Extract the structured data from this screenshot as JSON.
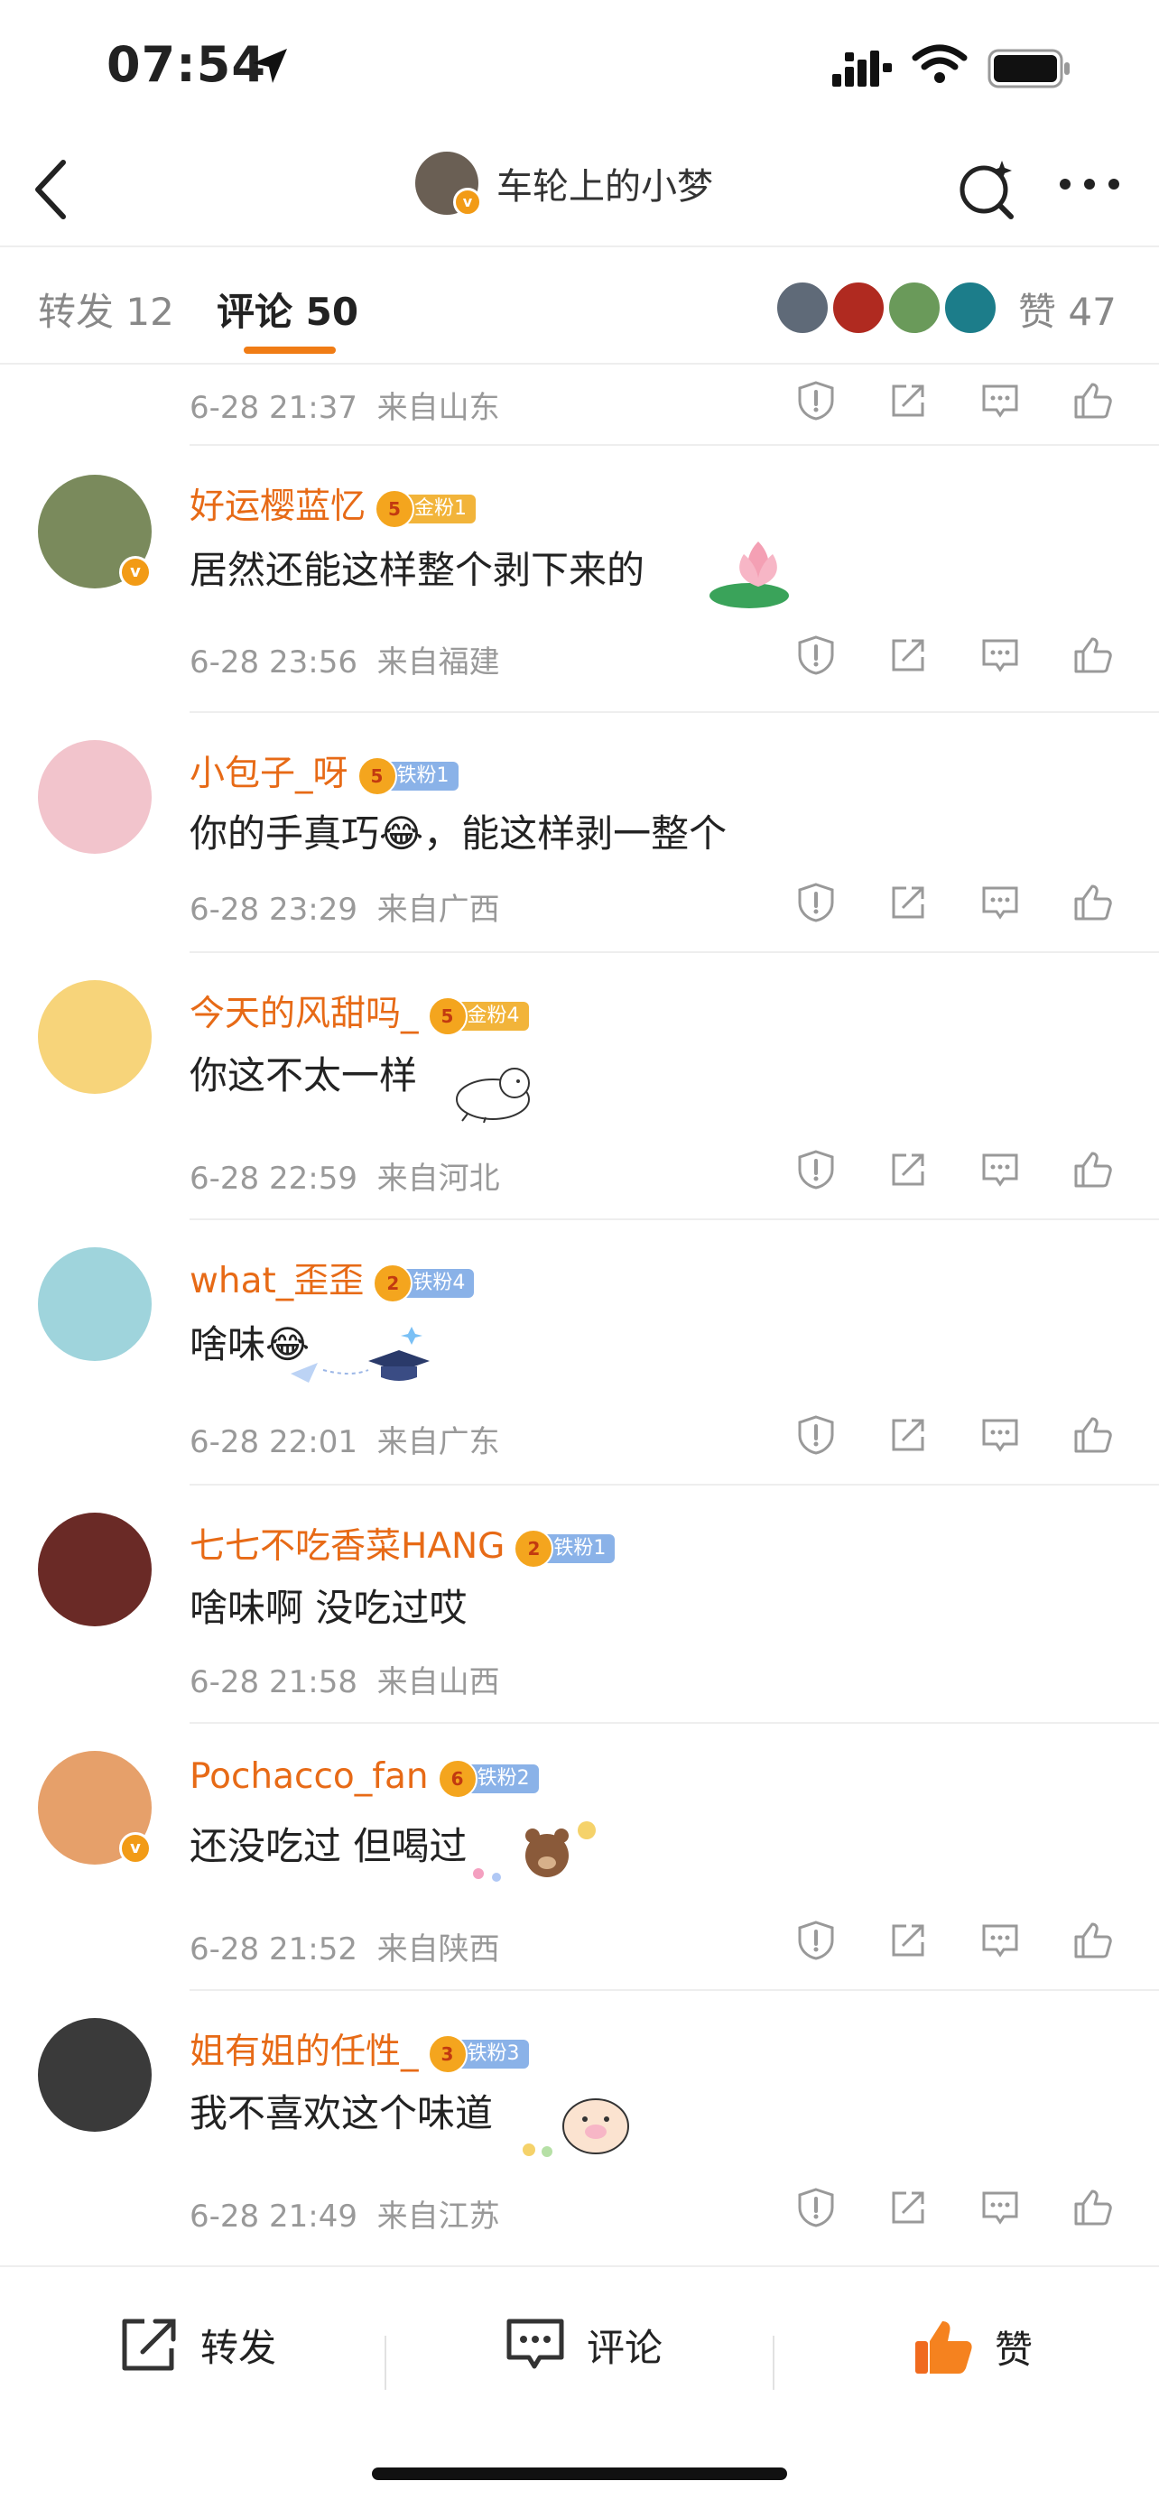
{
  "status": {
    "time": "07:54"
  },
  "header": {
    "title": "车轮上的小梦",
    "vbadge": "v"
  },
  "tabs": {
    "repost": "转发 12",
    "comments": "评论 50",
    "likes": "赞 47"
  },
  "top_meta": {
    "date": "6-28 21:37",
    "location": "来自山东"
  },
  "comments": [
    {
      "user": "好运樱蓝忆",
      "fan": "金粉1",
      "fan_level": "5",
      "text": "居然还能这样整个剥下来的",
      "date": "6-28 23:56",
      "location": "来自福建",
      "avatar_color": "#7a8a5c"
    },
    {
      "user": "小包子_呀",
      "fan": "铁粉1",
      "fan_level": "5",
      "text": "你的手真巧😂，能这样剥一整个",
      "date": "6-28 23:29",
      "location": "来自广西",
      "avatar_color": "#f2c4cc"
    },
    {
      "user": "今天的风甜吗_",
      "fan": "金粉4",
      "fan_level": "5",
      "text": "你这不太一样",
      "date": "6-28 22:59",
      "location": "来自河北",
      "avatar_color": "#f7d47a"
    },
    {
      "user": "what_歪歪",
      "fan": "铁粉4",
      "fan_level": "2",
      "text": "啥味😂",
      "date": "6-28 22:01",
      "location": "来自广东",
      "avatar_color": "#9fd4dc"
    },
    {
      "user": "七七不吃香菜HANG",
      "fan": "铁粉1",
      "fan_level": "2",
      "text": "啥味啊 没吃过哎",
      "date": "6-28 21:58",
      "location": "来自山西",
      "avatar_color": "#6a2a26"
    },
    {
      "user": "Pochacco_fan",
      "fan": "铁粉2",
      "fan_level": "6",
      "text": "还没吃过 但喝过",
      "date": "6-28 21:52",
      "location": "来自陕西",
      "avatar_color": "#e6a06a"
    },
    {
      "user": "姐有姐的任性_",
      "fan": "铁粉3",
      "fan_level": "3",
      "text": "我不喜欢这个味道",
      "date": "6-28 21:49",
      "location": "来自江苏",
      "avatar_color": "#3a3a3a"
    }
  ],
  "bottom": {
    "repost": "转发",
    "comment": "评论",
    "like": "赞"
  },
  "colors": {
    "accent": "#f07c15",
    "username": "#e76a16",
    "meta": "#999999"
  }
}
